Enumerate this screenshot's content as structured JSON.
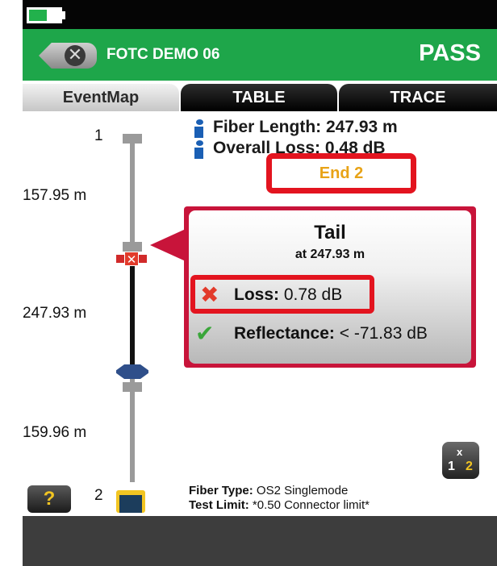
{
  "colors": {
    "header_green": "#1ea64a",
    "alert_red": "#e3141f",
    "end_label_amber": "#e8a317",
    "info_blue": "#1a5fb4",
    "check_green": "#3aa63a"
  },
  "header": {
    "title": "FOTC DEMO 06",
    "result": "PASS",
    "back_icon": "close-back-icon"
  },
  "tabs": [
    {
      "label": "EventMap",
      "selected": true
    },
    {
      "label": "TABLE",
      "selected": false
    },
    {
      "label": "TRACE",
      "selected": false
    }
  ],
  "summary": {
    "fiber_length": "Fiber Length:  247.93 m",
    "overall_loss": "Overall Loss:  0.48 dB",
    "end_label": "End 2"
  },
  "map": {
    "node_start": "1",
    "node_end": "2",
    "segments": [
      "157.95 m",
      "247.93 m",
      "159.96 m"
    ]
  },
  "event_popup": {
    "title": "Tail",
    "subtitle": "at 247.93 m",
    "loss_label": "Loss:",
    "loss_value": " 0.78 dB",
    "loss_status_icon": "fail-x-icon",
    "reflectance_label": "Reflectance:",
    "reflectance_value": " < -71.83 dB",
    "reflectance_status_icon": "pass-check-icon"
  },
  "footer": {
    "fiber_type_label": "Fiber Type:",
    "fiber_type_value": " OS2 Singlemode",
    "test_limit_label": "Test Limit:",
    "test_limit_value": " *0.50 Connector limit*",
    "help_label": "?",
    "swap_left": "1",
    "swap_right": "2",
    "swap_mid": "x"
  }
}
